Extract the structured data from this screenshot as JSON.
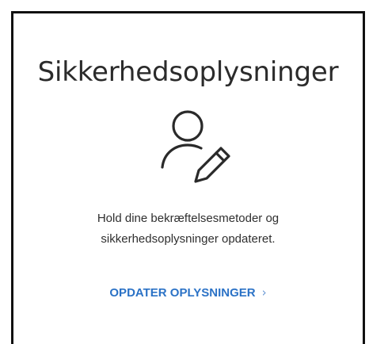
{
  "card": {
    "title": "Sikkerhedsoplysninger",
    "icon": "user-edit-icon",
    "description_line1": "Hold dine bekræftelsesmetoder og",
    "description_line2": "sikkerhedsoplysninger opdateret.",
    "link_label": "OPDATER OPLYSNINGER",
    "link_chevron": "›"
  },
  "colors": {
    "title": "#2b2b2b",
    "text": "#2f2f2f",
    "link": "#2b72c6",
    "border": "#111111"
  }
}
